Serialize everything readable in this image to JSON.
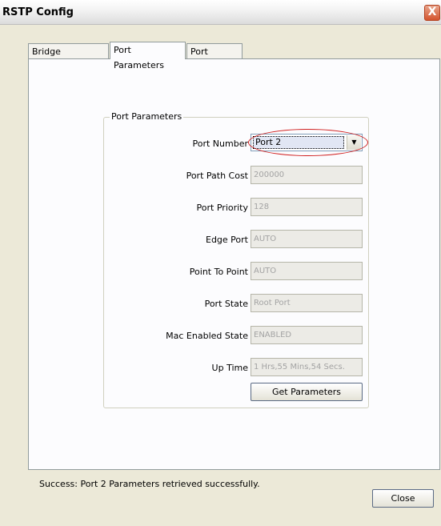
{
  "window": {
    "title": "RSTP Config",
    "close_glyph": "X"
  },
  "tabs": [
    {
      "label": "Bridge Parameters",
      "active": false
    },
    {
      "label": "Port Parameters",
      "active": true
    },
    {
      "label": "Port States",
      "active": false
    }
  ],
  "group": {
    "title": "Port Parameters",
    "port_number": {
      "label": "Port Number",
      "value": "Port 2"
    },
    "fields": [
      {
        "label": "Port Path Cost",
        "value": "200000"
      },
      {
        "label": "Port Priority",
        "value": "128"
      },
      {
        "label": "Edge Port",
        "value": "AUTO"
      },
      {
        "label": "Point To Point",
        "value": "AUTO"
      },
      {
        "label": "Port State",
        "value": "Root Port"
      },
      {
        "label": "Mac Enabled State",
        "value": "ENABLED"
      },
      {
        "label": "Up Time",
        "value": "1 Hrs,55 Mins,54 Secs."
      }
    ],
    "get_button": "Get Parameters"
  },
  "status": "Success: Port 2 Parameters retrieved successfully.",
  "close_button": "Close",
  "colors": {
    "highlight_ring": "#d02020",
    "accent": "#316ac5"
  }
}
